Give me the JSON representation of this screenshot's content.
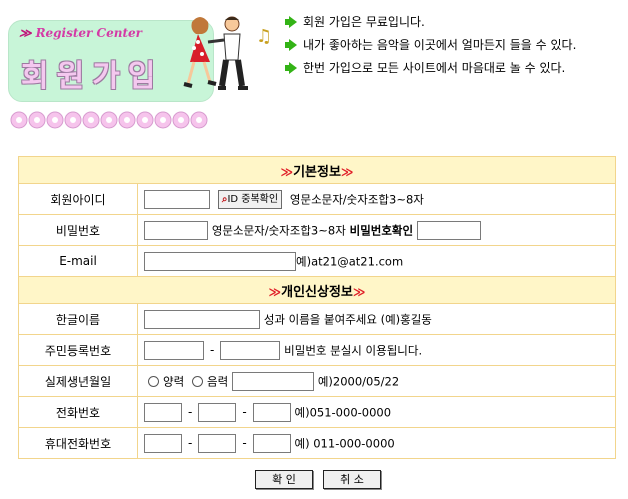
{
  "banner": {
    "tag": "Register Center",
    "title": "회원가입"
  },
  "notices": [
    "회원 가입은 무료입니다.",
    "내가 좋아하는 음악을 이곳에서 얼마든지 들을 수 있다.",
    "한번 가입으로 모든 사이트에서 마음대로 놀 수 있다."
  ],
  "sections": {
    "basic": "기본정보",
    "personal": "개인신상정보"
  },
  "fields": {
    "member_id": {
      "label": "회원아이디",
      "value": "",
      "button": "ID 중복확인",
      "hint": "영문소문자/숫자조합3~8자"
    },
    "password": {
      "label": "비밀번호",
      "value": "",
      "hint": "영문소문자/숫자조합3~8자",
      "confirm_label": "비밀번호확인",
      "confirm_value": ""
    },
    "email": {
      "label": "E-mail",
      "value": "",
      "hint": "예)at21@at21.com"
    },
    "korean_name": {
      "label": "한글이름",
      "value": "",
      "hint": "성과 이름을 붙여주세요 (예)홍길동"
    },
    "resident_no": {
      "label": "주민등록번호",
      "value1": "",
      "value2": "",
      "hint": "비밀번호 분실시 이용됩니다."
    },
    "birthday": {
      "label": "실제생년월일",
      "option_solar": "양력",
      "option_lunar": "음력",
      "value": "",
      "hint": "예)2000/05/22"
    },
    "phone": {
      "label": "전화번호",
      "hint": "예)051-000-0000"
    },
    "mobile": {
      "label": "휴대전화번호",
      "hint": "예) 011-000-0000"
    }
  },
  "buttons": {
    "confirm": "확 인",
    "cancel": "취 소"
  },
  "colors": {
    "section_bg": "#fff6c8",
    "border": "#f2d58c",
    "accent_red": "#e01f28",
    "bullet_green": "#33b316"
  }
}
